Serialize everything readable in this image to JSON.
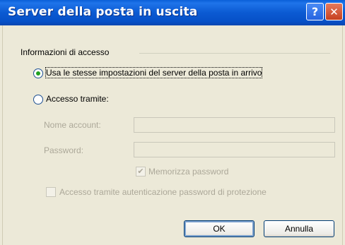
{
  "window": {
    "title": "Server della posta in uscita",
    "help_label": "?",
    "close_label": "✕"
  },
  "group": {
    "label": "Informazioni di accesso"
  },
  "options": {
    "same_settings_label": "Usa le stesse impostazioni del server della posta in arrivo",
    "login_with_label": "Accesso tramite:"
  },
  "fields": {
    "account_label": "Nome account:",
    "account_value": "",
    "password_label": "Password:",
    "password_value": "",
    "remember_label": "Memorizza password",
    "spa_label": "Accesso tramite autenticazione password di protezione"
  },
  "buttons": {
    "ok_label": "OK",
    "cancel_label": "Annulla"
  }
}
